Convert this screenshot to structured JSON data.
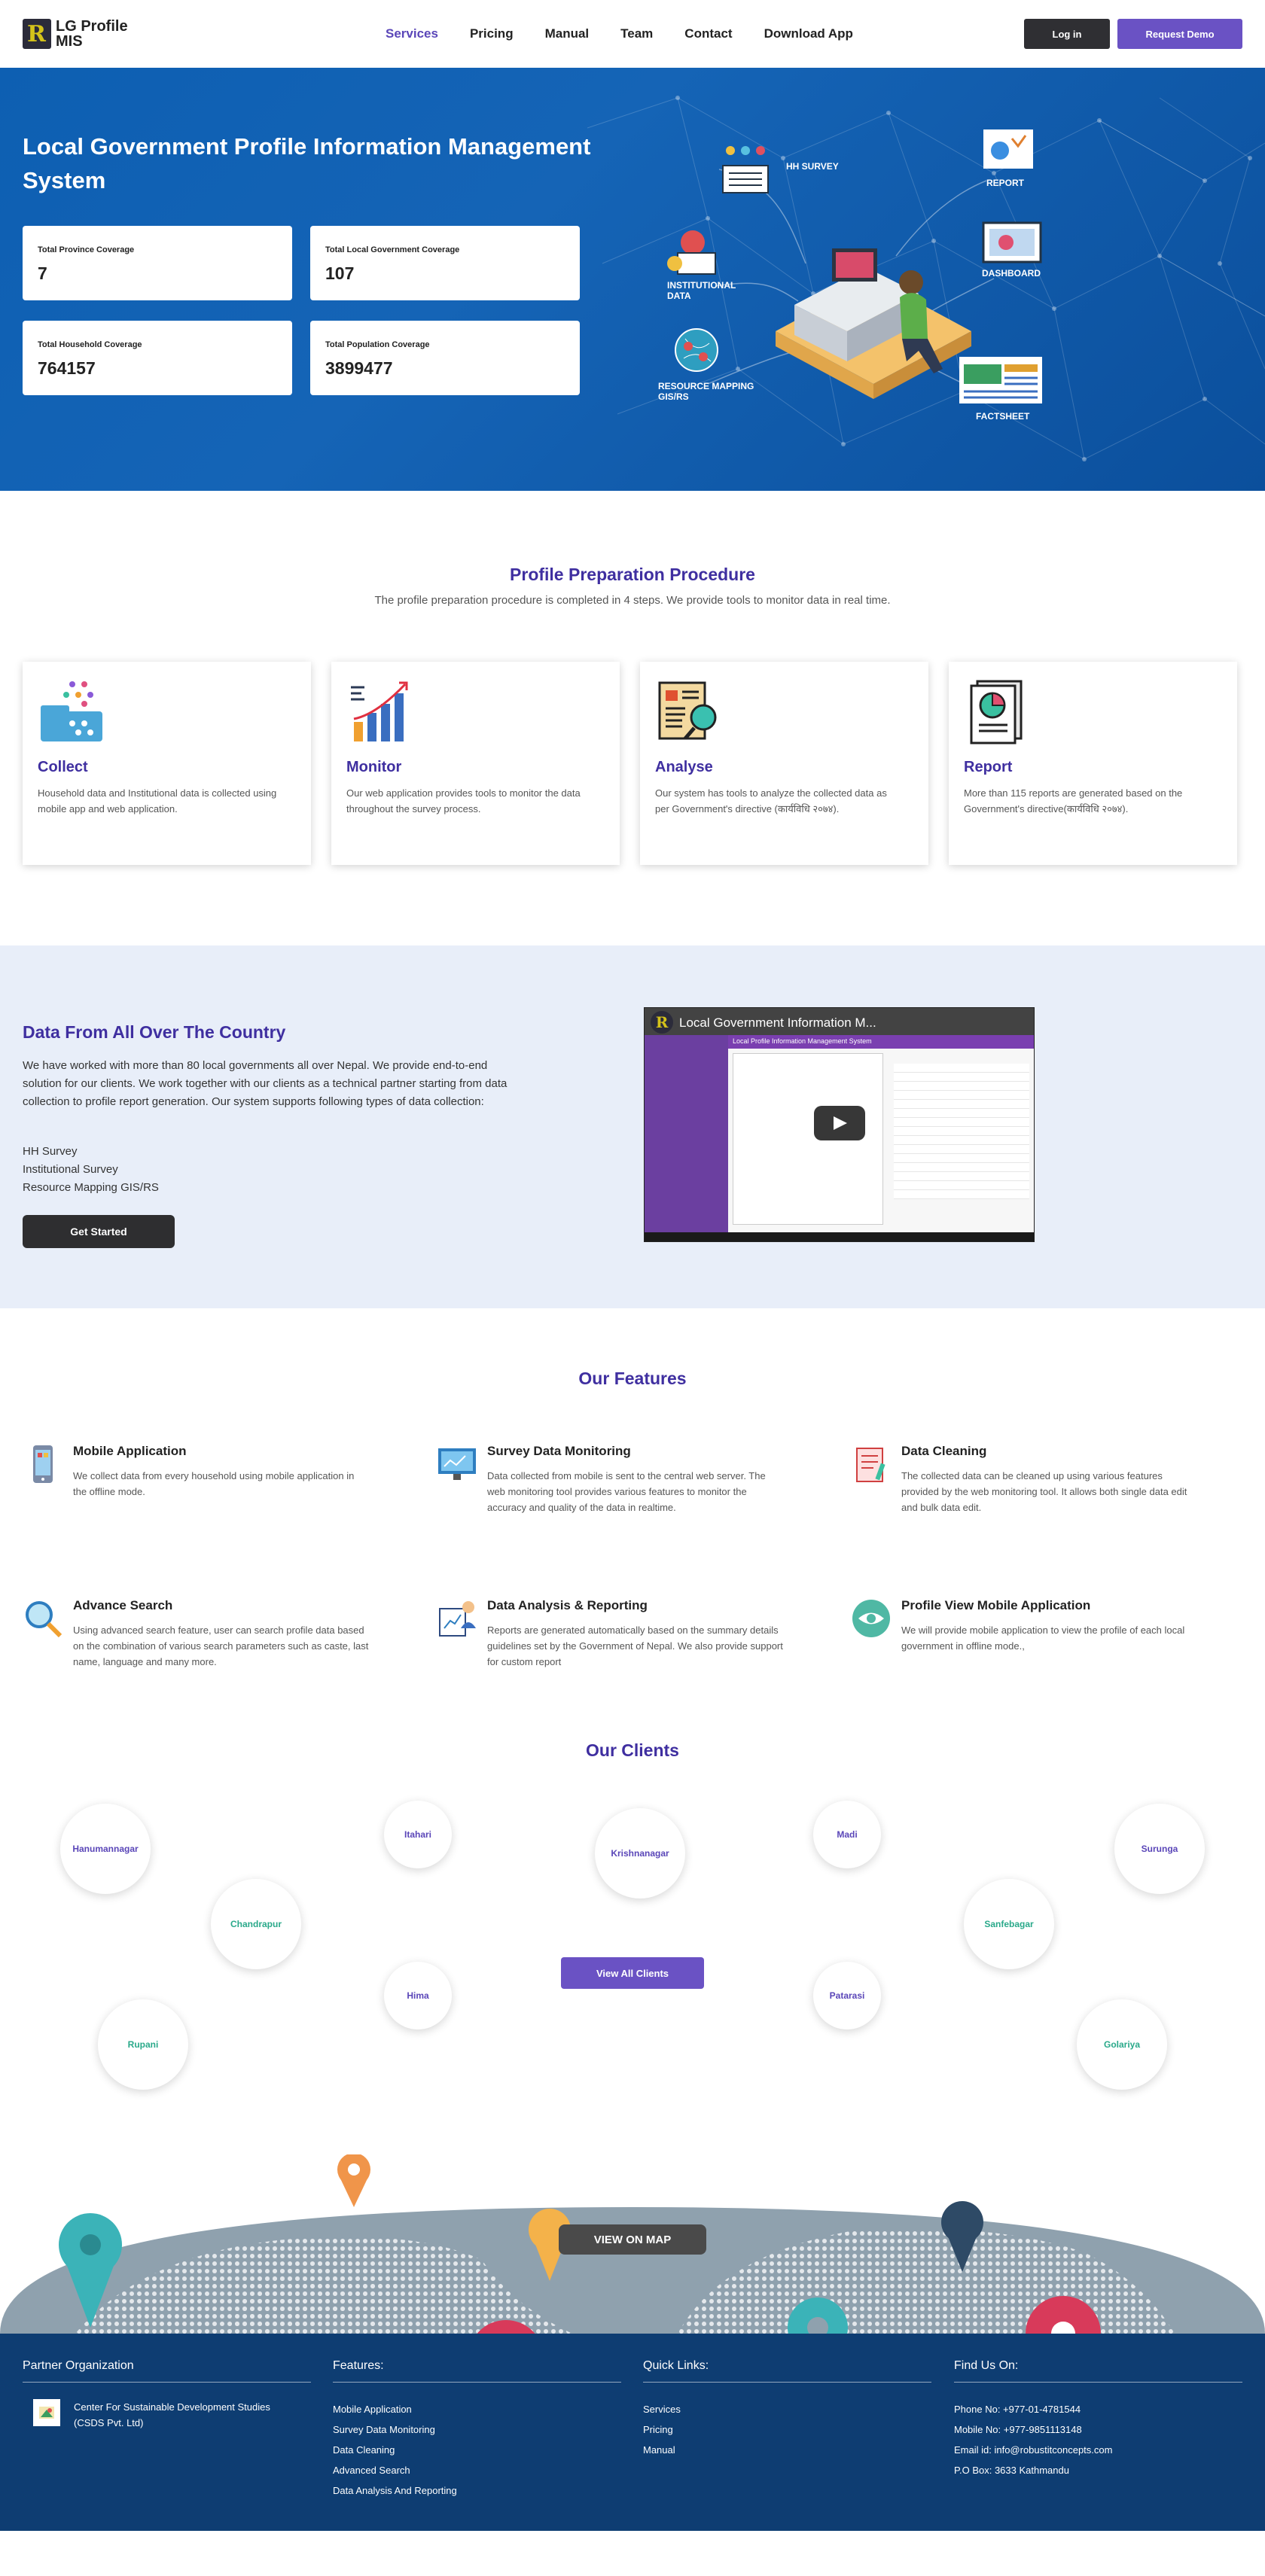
{
  "nav": {
    "logo_line1": "LG Profile",
    "logo_line2": "MIS",
    "items": [
      "Services",
      "Pricing",
      "Manual",
      "Team",
      "Contact",
      "Download App"
    ],
    "login": "Log in",
    "demo": "Request Demo"
  },
  "hero": {
    "title": "Local Government Profile Information Management System",
    "stats": [
      {
        "label": "Total Province Coverage",
        "value": "7"
      },
      {
        "label": "Total Local Government Coverage",
        "value": "107"
      },
      {
        "label": "Total Household Coverage",
        "value": "764157"
      },
      {
        "label": "Total Population Coverage",
        "value": "3899477"
      }
    ],
    "illustration_tags": {
      "hh": "HH SURVEY",
      "report": "REPORT",
      "inst1": "INSTITUTIONAL",
      "inst2": "DATA",
      "dash": "DASHBOARD",
      "res1": "RESOURCE MAPPING",
      "res2": "GIS/RS",
      "fact": "FACTSHEET"
    }
  },
  "procedure": {
    "title": "Profile Preparation Procedure",
    "subtitle": "The profile preparation procedure is completed in 4 steps. We provide tools to monitor data in real time.",
    "steps": [
      {
        "title": "Collect",
        "text": "Household data and Institutional data is collected using mobile app and web application."
      },
      {
        "title": "Monitor",
        "text": "Our web application provides tools to monitor the data throughout the survey process."
      },
      {
        "title": "Analyse",
        "text": "Our system has tools to analyze the collected data as per Government's directive (कार्यविधि २०७४)."
      },
      {
        "title": "Report",
        "text": "More than 115 reports are generated based on the Government's directive(कार्यविधि २०७४)."
      }
    ]
  },
  "country": {
    "title": "Data From All Over The Country",
    "text": "We have worked with more than 80 local governments all over Nepal. We provide end-to-end solution for our clients. We work together with our clients as a technical partner starting from data collection to profile report generation. Our system supports following types of data collection:",
    "types": [
      "HH Survey",
      "Institutional Survey",
      "Resource Mapping GIS/RS"
    ],
    "button": "Get Started",
    "video_title": "Local Government Information M...",
    "video_app": "Local Profile Information Management System"
  },
  "features": {
    "title": "Our Features",
    "items": [
      {
        "title": "Mobile Application",
        "text": "We collect data from every household using mobile application in the offline mode."
      },
      {
        "title": "Survey Data Monitoring",
        "text": "Data collected from mobile is sent to the central web server. The web monitoring tool provides various features to monitor the accuracy and quality of the data in realtime."
      },
      {
        "title": "Data Cleaning",
        "text": "The collected data can be cleaned up using various features provided by the web monitoring tool. It allows both single data edit and bulk data edit."
      },
      {
        "title": "Advance Search",
        "text": "Using advanced search feature, user can search profile data based on the combination of various search parameters such as caste, last name, language and many more."
      },
      {
        "title": "Data Analysis & Reporting",
        "text": "Reports are generated automatically based on the summary details guidelines set by the Government of Nepal. We also provide support for custom report"
      },
      {
        "title": "Profile View Mobile Application",
        "text": "We will provide mobile application to view the profile of each local government in offline mode.,"
      }
    ]
  },
  "clients": {
    "title": "Our Clients",
    "names": [
      "Hanumannagar",
      "Itahari",
      "Krishnanagar",
      "Madi",
      "Surunga",
      "Chandrapur",
      "Sanfebagar",
      "Hima",
      "Patarasi",
      "Rupani",
      "Golariya"
    ],
    "button": "View All Clients"
  },
  "map": {
    "button": "VIEW ON MAP"
  },
  "footer": {
    "partner_title": "Partner Organization",
    "partner_name": "Center For Sustainable Development Studies (CSDS Pvt. Ltd)",
    "features_title": "Features:",
    "features": [
      "Mobile Application",
      "Survey Data Monitoring",
      "Data Cleaning",
      "Advanced Search",
      "Data Analysis And Reporting"
    ],
    "links_title": "Quick Links:",
    "links": [
      "Services",
      "Pricing",
      "Manual"
    ],
    "find_title": "Find Us On:",
    "contacts": [
      "Phone No: +977-01-4781544",
      "Mobile No: +977-9851113148",
      "Email id: info@robustitconcepts.com",
      "P.O Box: 3633 Kathmandu"
    ]
  },
  "colors": {
    "brand": "#5a46b8",
    "hero": "#0d5fb2",
    "footer": "#0e3d72",
    "client_green": "#2aa98a"
  }
}
